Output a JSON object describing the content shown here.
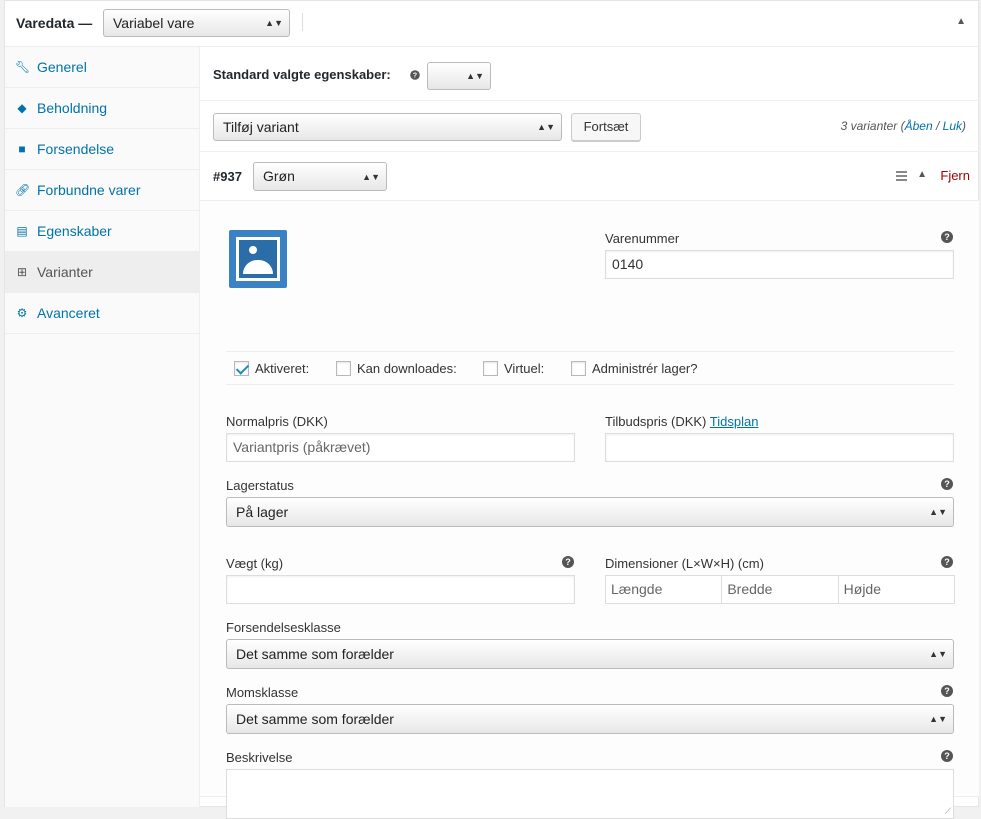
{
  "header": {
    "title": "Varedata —",
    "product_type": "Variabel vare"
  },
  "sidebar": {
    "items": [
      {
        "label": "Generel",
        "icon": "wrench-icon"
      },
      {
        "label": "Beholdning",
        "icon": "tag-icon"
      },
      {
        "label": "Forsendelse",
        "icon": "truck-icon"
      },
      {
        "label": "Forbundne varer",
        "icon": "link-icon"
      },
      {
        "label": "Egenskaber",
        "icon": "list-icon"
      },
      {
        "label": "Varianter",
        "icon": "grid-icon",
        "active": true
      },
      {
        "label": "Avanceret",
        "icon": "gear-icon"
      }
    ]
  },
  "defaults": {
    "label": "Standard valgte egenskaber:",
    "value": ""
  },
  "toolbar": {
    "add_select": "Tilføj variant",
    "go_button": "Fortsæt",
    "count_text": "3 varianter (",
    "open_link": "Åben",
    "sep": " / ",
    "close_link": "Luk",
    "count_end": ")"
  },
  "variation": {
    "id": "#937",
    "attribute": "Grøn",
    "remove": "Fjern",
    "sku_label": "Varenummer",
    "sku_value": "0140",
    "checkboxes": {
      "enabled": "Aktiveret:",
      "downloadable": "Kan downloades:",
      "virtual": "Virtuel:",
      "manage_stock": "Administrér lager?"
    },
    "regular_price_label": "Normalpris (DKK)",
    "regular_price_placeholder": "Variantpris (påkrævet)",
    "sale_price_label": "Tilbudspris (DKK)",
    "schedule_link": "Tidsplan",
    "stock_status_label": "Lagerstatus",
    "stock_status_value": "På lager",
    "weight_label": "Vægt (kg)",
    "dimensions_label": "Dimensioner (L×W×H) (cm)",
    "length_placeholder": "Længde",
    "width_placeholder": "Bredde",
    "height_placeholder": "Højde",
    "shipping_class_label": "Forsendelsesklasse",
    "shipping_class_value": "Det samme som forælder",
    "tax_class_label": "Momsklasse",
    "tax_class_value": "Det samme som forælder",
    "description_label": "Beskrivelse"
  },
  "colors": {
    "link": "#0073aa",
    "remove": "#aa0000",
    "image_placeholder": "#3a82c4"
  }
}
